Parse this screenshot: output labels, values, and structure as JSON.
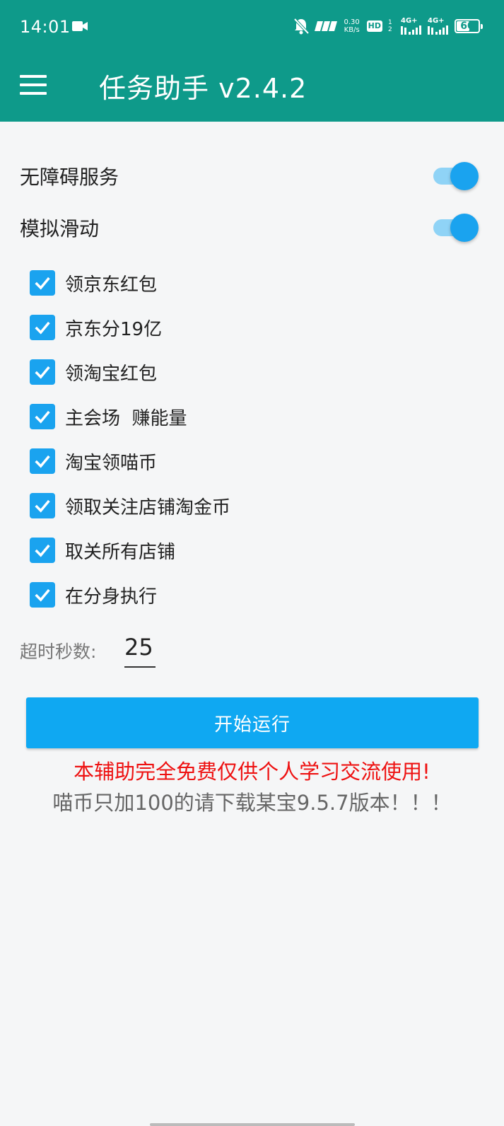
{
  "status_bar": {
    "time": "14:01",
    "net_speed_value": "0.30",
    "net_speed_unit": "KB/s",
    "hd_label": "HD",
    "sim_slots": "1 2",
    "signal_1_label": "4G+",
    "signal_2_label": "4G+",
    "battery_level": "60",
    "battery_fraction": 0.6
  },
  "app_bar": {
    "title": "任务助手  v2.4.2"
  },
  "switches": [
    {
      "label": "无障碍服务",
      "on": true
    },
    {
      "label": "模拟滑动",
      "on": true
    }
  ],
  "tasks": [
    {
      "label": "领京东红包",
      "checked": true
    },
    {
      "label": "京东分19亿",
      "checked": true
    },
    {
      "label": "领淘宝红包",
      "checked": true
    },
    {
      "label": "主会场  赚能量",
      "checked": true
    },
    {
      "label": "淘宝领喵币",
      "checked": true
    },
    {
      "label": "领取关注店铺淘金币",
      "checked": true
    },
    {
      "label": "取关所有店铺",
      "checked": true
    },
    {
      "label": "在分身执行",
      "checked": true
    }
  ],
  "timeout": {
    "label": "超时秒数:",
    "value": "25"
  },
  "start_button": {
    "label": "开始运行"
  },
  "notices": {
    "free_notice": "本辅助完全免费仅供个人学习交流使用!",
    "version_notice": "喵币只加100的请下载某宝9.5.7版本！！！"
  },
  "colors": {
    "header": "#0e9a8a",
    "accent": "#1aa3ef",
    "button": "#0fa8f2",
    "notice_red": "#ee1111",
    "notice_gray": "#666666"
  }
}
